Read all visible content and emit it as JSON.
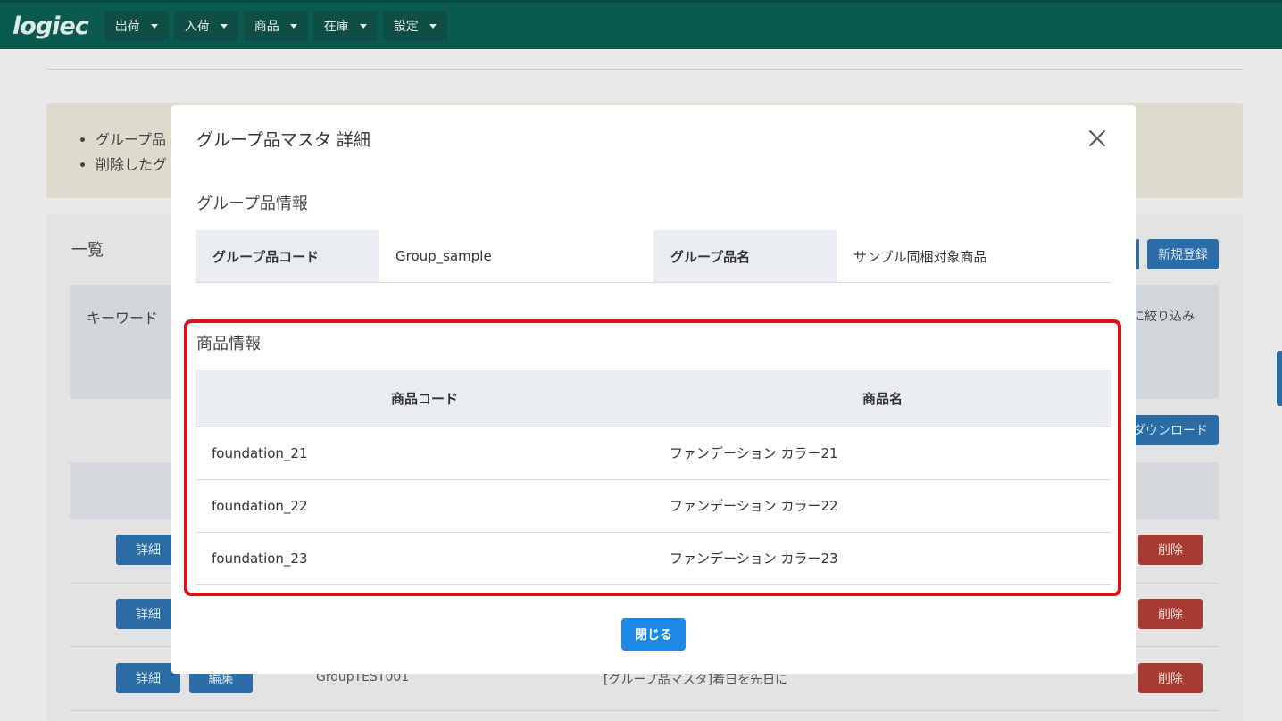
{
  "nav": {
    "logo": "logiec",
    "menus": [
      "出荷",
      "入荷",
      "商品",
      "在庫",
      "設定"
    ]
  },
  "background": {
    "notice_lines": [
      "グループ品",
      "削除したグ"
    ],
    "card_title": "一覧",
    "new_button": "新規登録",
    "filter_label": "キーワード",
    "filter_right": "に絞り込み",
    "download_button": "ダウンロード",
    "detail_button": "詳細",
    "edit_button": "編集",
    "delete_button": "削除",
    "row3_code": "GroupTEST001",
    "row3_name": "[グループ品マスタ]着日を先日に"
  },
  "modal": {
    "title": "グループ品マスタ 詳細",
    "group_section": "グループ品情報",
    "group_code_label": "グループ品コード",
    "group_code_value": "Group_sample",
    "group_name_label": "グループ品名",
    "group_name_value": "サンプル同梱対象商品",
    "product_section": "商品情報",
    "columns": [
      "商品コード",
      "商品名"
    ],
    "products": [
      {
        "code": "foundation_21",
        "name": "ファンデーション カラー21"
      },
      {
        "code": "foundation_22",
        "name": "ファンデーション カラー22"
      },
      {
        "code": "foundation_23",
        "name": "ファンデーション カラー23"
      }
    ],
    "close_label": "閉じる"
  }
}
